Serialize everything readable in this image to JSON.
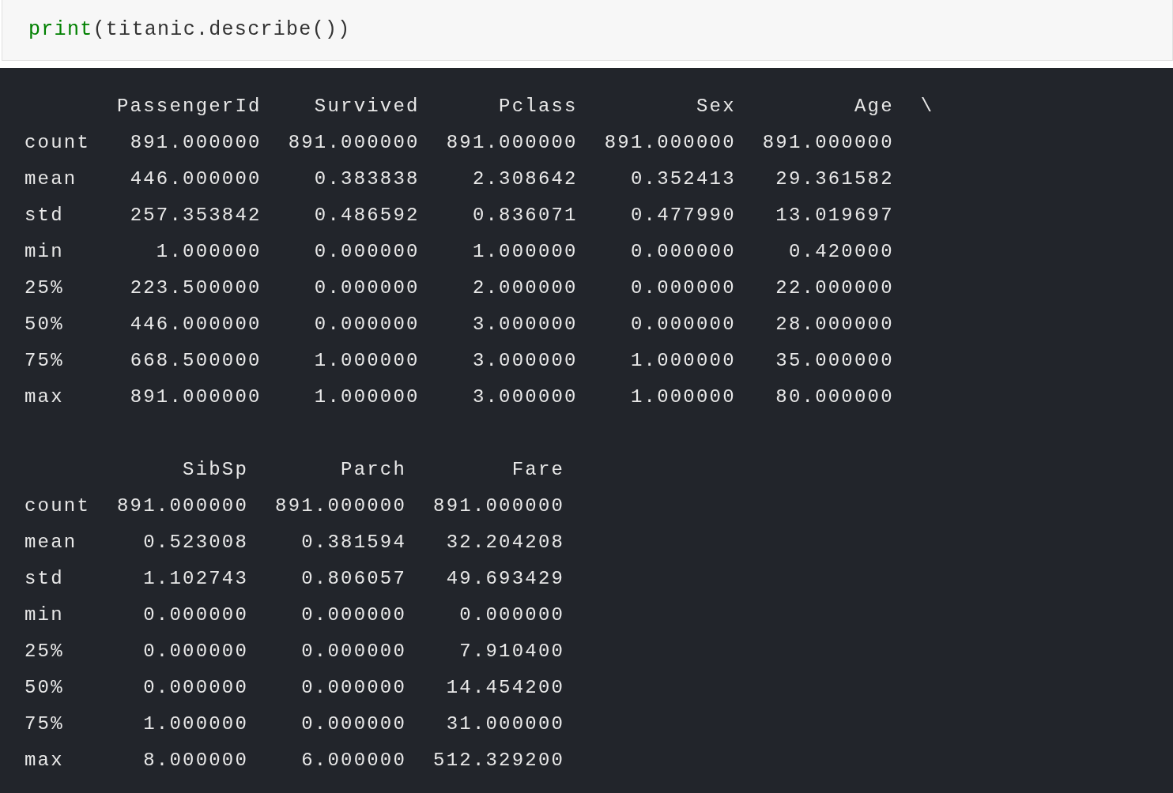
{
  "code_cell": {
    "tokens": [
      {
        "kind": "builtin",
        "text": "print"
      },
      {
        "kind": "plain",
        "text": "(titanic.describe())"
      }
    ]
  },
  "output": {
    "tables": [
      {
        "columns": [
          "PassengerId",
          "Survived",
          "Pclass",
          "Sex",
          "Age"
        ],
        "continuation": "\\",
        "rows": [
          {
            "label": "count",
            "values": [
              "891.000000",
              "891.000000",
              "891.000000",
              "891.000000",
              "891.000000"
            ]
          },
          {
            "label": "mean",
            "values": [
              "446.000000",
              "0.383838",
              "2.308642",
              "0.352413",
              "29.361582"
            ]
          },
          {
            "label": "std",
            "values": [
              "257.353842",
              "0.486592",
              "0.836071",
              "0.477990",
              "13.019697"
            ]
          },
          {
            "label": "min",
            "values": [
              "1.000000",
              "0.000000",
              "1.000000",
              "0.000000",
              "0.420000"
            ]
          },
          {
            "label": "25%",
            "values": [
              "223.500000",
              "0.000000",
              "2.000000",
              "0.000000",
              "22.000000"
            ]
          },
          {
            "label": "50%",
            "values": [
              "446.000000",
              "0.000000",
              "3.000000",
              "0.000000",
              "28.000000"
            ]
          },
          {
            "label": "75%",
            "values": [
              "668.500000",
              "1.000000",
              "3.000000",
              "1.000000",
              "35.000000"
            ]
          },
          {
            "label": "max",
            "values": [
              "891.000000",
              "1.000000",
              "3.000000",
              "1.000000",
              "80.000000"
            ]
          }
        ]
      },
      {
        "columns": [
          "SibSp",
          "Parch",
          "Fare"
        ],
        "rows": [
          {
            "label": "count",
            "values": [
              "891.000000",
              "891.000000",
              "891.000000"
            ]
          },
          {
            "label": "mean",
            "values": [
              "0.523008",
              "0.381594",
              "32.204208"
            ]
          },
          {
            "label": "std",
            "values": [
              "1.102743",
              "0.806057",
              "49.693429"
            ]
          },
          {
            "label": "min",
            "values": [
              "0.000000",
              "0.000000",
              "0.000000"
            ]
          },
          {
            "label": "25%",
            "values": [
              "0.000000",
              "0.000000",
              "7.910400"
            ]
          },
          {
            "label": "50%",
            "values": [
              "0.000000",
              "0.000000",
              "14.454200"
            ]
          },
          {
            "label": "75%",
            "values": [
              "1.000000",
              "0.000000",
              "31.000000"
            ]
          },
          {
            "label": "max",
            "values": [
              "8.000000",
              "6.000000",
              "512.329200"
            ]
          }
        ]
      }
    ]
  }
}
